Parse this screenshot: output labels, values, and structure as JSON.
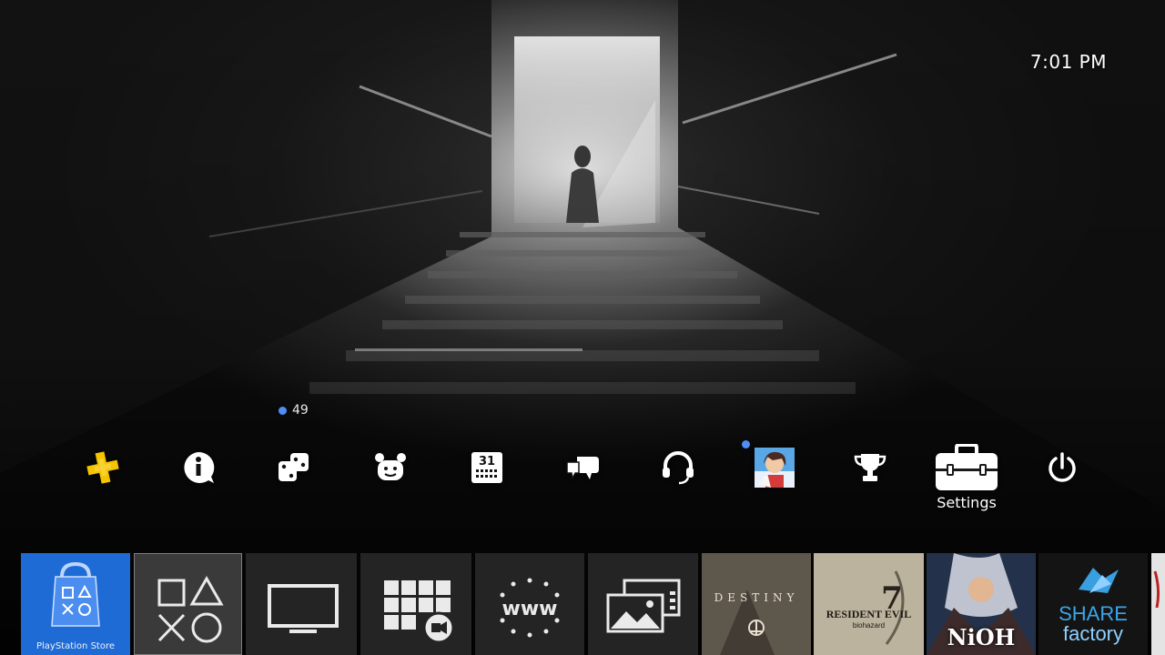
{
  "clock": {
    "time": "7:01 PM"
  },
  "function_bar": {
    "items": [
      {
        "name": "playstation-plus-icon",
        "label": ""
      },
      {
        "name": "whats-new-icon",
        "label": ""
      },
      {
        "name": "notifications-icon",
        "label": "",
        "badge": "49"
      },
      {
        "name": "friends-icon",
        "label": ""
      },
      {
        "name": "events-icon",
        "label": "",
        "day": "31"
      },
      {
        "name": "messages-icon",
        "label": ""
      },
      {
        "name": "party-icon",
        "label": ""
      },
      {
        "name": "profile-avatar",
        "label": ""
      },
      {
        "name": "trophies-icon",
        "label": ""
      },
      {
        "name": "settings-icon",
        "label": "Settings",
        "selected": true
      },
      {
        "name": "power-icon",
        "label": ""
      }
    ]
  },
  "tiles": [
    {
      "name": "playstation-store",
      "caption": "PlayStation Store"
    },
    {
      "name": "library",
      "caption": ""
    },
    {
      "name": "tv-video",
      "caption": ""
    },
    {
      "name": "media-player",
      "caption": ""
    },
    {
      "name": "internet-browser",
      "caption": "",
      "glyph": "www"
    },
    {
      "name": "capture-gallery",
      "caption": ""
    },
    {
      "name": "destiny",
      "caption": "",
      "title": "DESTINY"
    },
    {
      "name": "resident-evil",
      "caption": "",
      "title": "RESIDENT EVIL",
      "subtitle": "biohazard",
      "number": "7"
    },
    {
      "name": "nioh",
      "caption": "",
      "title": "NiOH"
    },
    {
      "name": "share-factory",
      "caption": "",
      "title_top": "SHARE",
      "title_bottom": "factory"
    }
  ],
  "colors": {
    "ps_plus_yellow": "#f5c400",
    "store_blue": "#1f6bd6",
    "notification_dot": "#4f8ef7",
    "store_text": "#ffffff"
  }
}
